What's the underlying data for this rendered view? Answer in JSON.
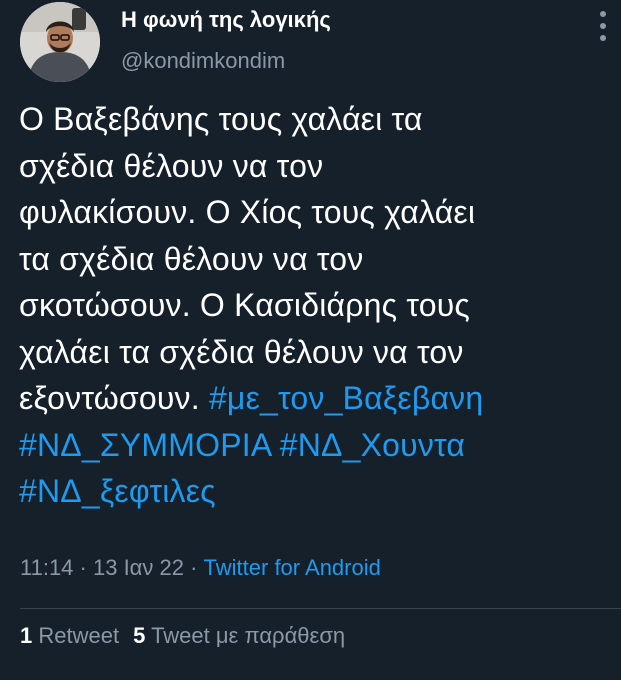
{
  "author": {
    "display_name": "Η φωνή της λογικής",
    "handle": "@kondimkondim"
  },
  "tweet": {
    "text_lines": [
      "Ο Βαξεβάνης τους χαλάει τα",
      "σχέδια θέλουν να τον",
      "φυλακίσουν. Ο Χίος τους χαλάει",
      "τα σχέδια θέλουν να τον",
      "σκοτώσουν. Ο Κασιδιάρης τους",
      "χαλάει τα σχέδια θέλουν να τον",
      "εξοντώσουν. "
    ],
    "hashtags": [
      "#με_τον_Βαξεβανη",
      "#ΝΔ_ΣΥΜΜΟΡΙΑ",
      "#ΝΔ_Χουντα",
      "#ΝΔ_ξεφτιλες"
    ]
  },
  "meta": {
    "time": "11:14",
    "separator": " · ",
    "date": "13 Ιαν 22",
    "source": "Twitter for Android"
  },
  "stats": {
    "retweets_count": "1",
    "retweets_label": "Retweet",
    "quotes_count": "5",
    "quotes_label": "Tweet με παράθεση"
  },
  "colors": {
    "background": "#15202b",
    "text": "#ffffff",
    "secondary": "#8b98a5",
    "link": "#1d9bf0",
    "divider": "#38444d"
  },
  "icons": {
    "more": "more-options-icon (vertical three dots)"
  }
}
